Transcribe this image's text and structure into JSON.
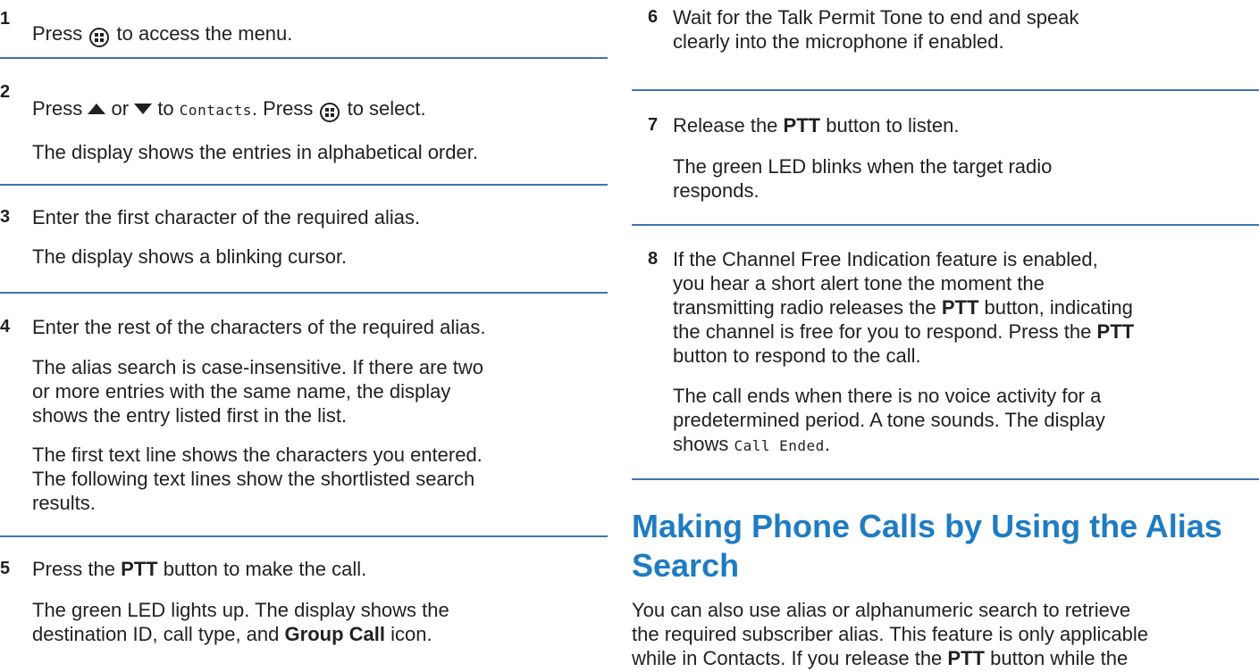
{
  "steps": {
    "s1": {
      "num": "1",
      "pre": "Press",
      "post": "to access the menu."
    },
    "s2": {
      "num": "2",
      "pre": "Press",
      "or": "or",
      "to": "to",
      "menu_item": "Contacts",
      "press2": ". Press",
      "post": "to select.",
      "result": "The display shows the entries in alphabetical order."
    },
    "s3": {
      "num": "3",
      "text": "Enter the first character of the required alias.",
      "result": "The display shows a blinking cursor."
    },
    "s4": {
      "num": "4",
      "text": "Enter the rest of the characters of the required alias.",
      "r1": "The alias search is case-insensitive. If there are two",
      "r2": "or more entries with the same name, the display",
      "r3": "shows the entry listed first in the list.",
      "r4": "The first text line shows the characters you entered.",
      "r5": "The following text lines show the shortlisted search",
      "r6": "results."
    },
    "s5": {
      "num": "5",
      "pre": "Press the",
      "bold": "PTT",
      "post": "button to make the call.",
      "r1": "The green LED lights up. The display shows the",
      "r2_pre": "destination ID, call type, and",
      "r2_bold": "Group Call",
      "r2_post": "icon."
    },
    "s6": {
      "num": "6",
      "l1": "Wait for the Talk Permit Tone to end and speak",
      "l2": "clearly into the microphone if enabled."
    },
    "s7": {
      "num": "7",
      "pre": "Release the",
      "bold": "PTT",
      "post": "button to listen.",
      "r1": "The green LED blinks when the target radio",
      "r2": "responds."
    },
    "s8": {
      "num": "8",
      "l1": "If the Channel Free Indication feature is enabled,",
      "l2": "you hear a short alert tone the moment the",
      "l3_pre": "transmitting radio releases the",
      "l3_bold": "PTT",
      "l3_post": "button, indicating",
      "l4_pre": "the channel is free for you to respond. Press the",
      "l4_bold": "PTT",
      "l5": "button to respond to the call.",
      "r1": "The call ends when there is no voice activity for a",
      "r2": "predetermined period. A tone sounds. The display",
      "r3_pre": "shows",
      "r3_mono": "Call Ended",
      "r3_post": "."
    }
  },
  "section": {
    "heading_l1": "Making Phone Calls by Using the Alias",
    "heading_l2": "Search",
    "p1": "You can also use alias or alphanumeric search to retrieve",
    "p2": "the required subscriber alias. This feature is only applicable",
    "p3_pre": "while in Contacts. If you release the",
    "p3_bold": "PTT",
    "p3_post": "button while the"
  },
  "colors": {
    "rule": "#3f74ad",
    "heading": "#1f7cc2",
    "text": "#231f20"
  },
  "icons": [
    "menu-ok-icon",
    "up-arrow-icon",
    "down-arrow-icon"
  ]
}
